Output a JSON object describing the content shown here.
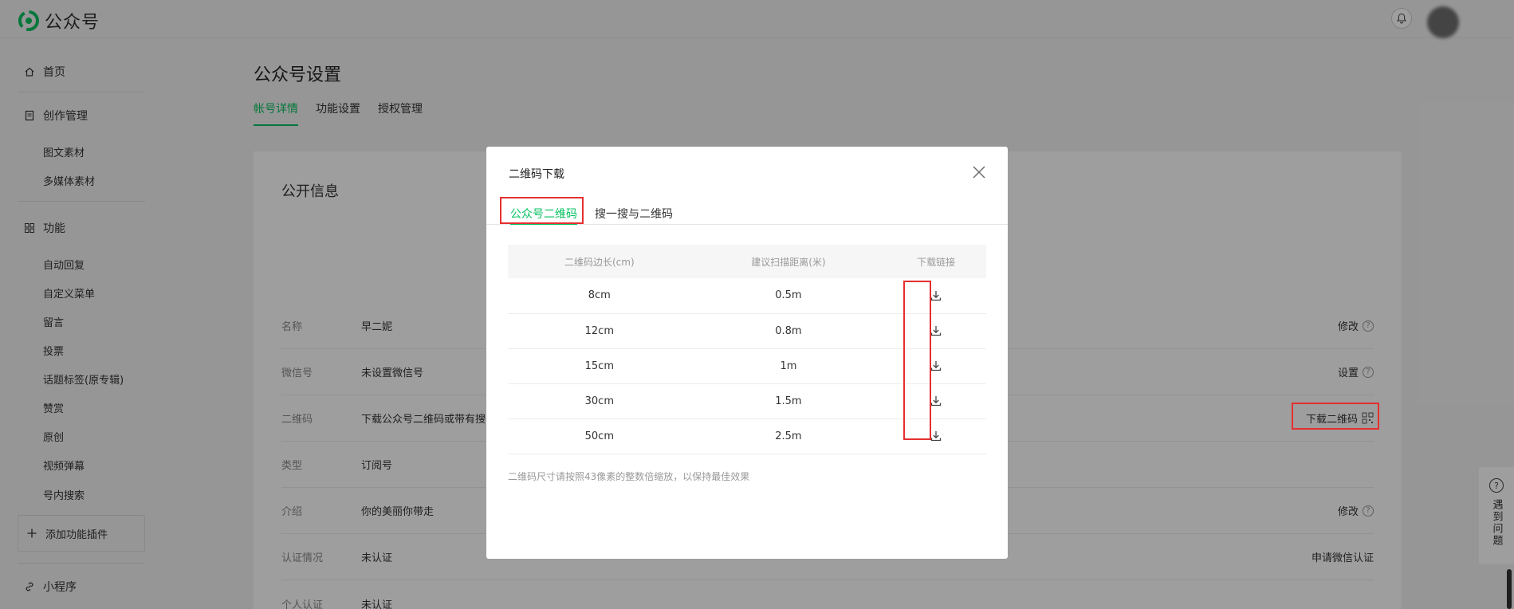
{
  "app": {
    "name": "公众号",
    "brand_color": "#07c160"
  },
  "header": {
    "bell_icon": "bell-icon"
  },
  "sidebar": {
    "home": "首页",
    "creation": "创作管理",
    "creation_items": [
      "图文素材",
      "多媒体素材"
    ],
    "features": "功能",
    "feature_items": [
      "自动回复",
      "自定义菜单",
      "留言",
      "投票",
      "话题标签(原专辑)",
      "赞赏",
      "原创",
      "视频弹幕",
      "号内搜索"
    ],
    "add_plugin": "添加功能插件",
    "mini_program": "小程序"
  },
  "page": {
    "title": "公众号设置",
    "tabs": [
      "帐号详情",
      "功能设置",
      "授权管理"
    ]
  },
  "card": {
    "title": "公开信息",
    "rows": [
      {
        "label": "名称",
        "value": "早二妮",
        "action": "修改"
      },
      {
        "label": "微信号",
        "value": "未设置微信号",
        "action": "设置"
      },
      {
        "label": "二维码",
        "value": "下载公众号二维码或带有搜一",
        "action": "下载二维码"
      },
      {
        "label": "类型",
        "value": "订阅号",
        "action": ""
      },
      {
        "label": "介绍",
        "value": "你的美丽你带走",
        "action": "修改"
      },
      {
        "label": "认证情况",
        "value": "未认证",
        "action": "申请微信认证"
      },
      {
        "label": "个人认证",
        "value": "未认证",
        "action": ""
      }
    ]
  },
  "dialog": {
    "title": "二维码下载",
    "tabs": [
      "公众号二维码",
      "搜一搜与二维码"
    ],
    "columns": [
      "二维码边长(cm)",
      "建议扫描距离(米)",
      "下载链接"
    ],
    "rows": [
      {
        "size": "8cm",
        "distance": "0.5m"
      },
      {
        "size": "12cm",
        "distance": "0.8m"
      },
      {
        "size": "15cm",
        "distance": "1m"
      },
      {
        "size": "30cm",
        "distance": "1.5m"
      },
      {
        "size": "50cm",
        "distance": "2.5m"
      }
    ],
    "note": "二维码尺寸请按照43像素的整数倍缩放，以保持最佳效果"
  },
  "help": {
    "label": "遇到问题",
    "icon": "?"
  }
}
